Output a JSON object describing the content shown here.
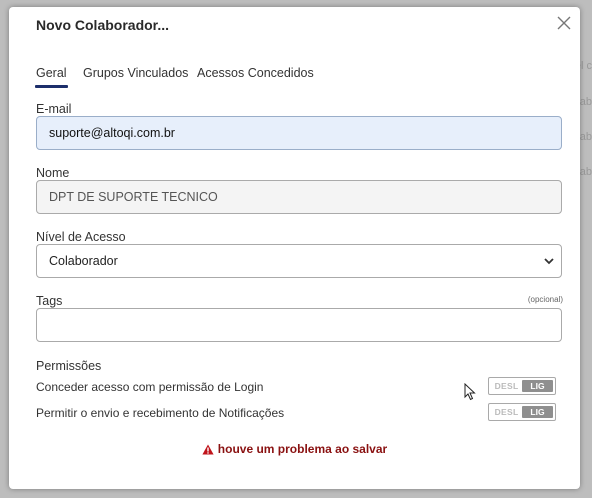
{
  "background_hints": [
    "el c",
    "Jab",
    "Jab",
    "Jab"
  ],
  "dialog": {
    "title": "Novo Colaborador...",
    "tabs": [
      {
        "label": "Geral",
        "active": true
      },
      {
        "label": "Grupos Vinculados",
        "active": false
      },
      {
        "label": "Acessos Concedidos",
        "active": false
      }
    ],
    "email": {
      "label": "E-mail",
      "value": "suporte@altoqi.com.br"
    },
    "nome": {
      "label": "Nome",
      "value": "DPT DE SUPORTE TECNICO"
    },
    "nivel": {
      "label": "Nível de Acesso",
      "value": "Colaborador"
    },
    "tags": {
      "label": "Tags",
      "optional_note": "(opcional)",
      "value": ""
    },
    "permissions": {
      "heading": "Permissões",
      "items": [
        {
          "label": "Conceder acesso com permissão de Login",
          "off_label": "DESL",
          "on_label": "LIG",
          "state": "on"
        },
        {
          "label": "Permitir o envio e recebimento de Notificações",
          "off_label": "DESL",
          "on_label": "LIG",
          "state": "on"
        }
      ]
    },
    "error_message": "houve um problema ao salvar"
  },
  "colors": {
    "tab_underline": "#1d2f6b",
    "error_text": "#8a1111",
    "warning_icon": "#c0141b",
    "email_bg": "#e7effb"
  }
}
